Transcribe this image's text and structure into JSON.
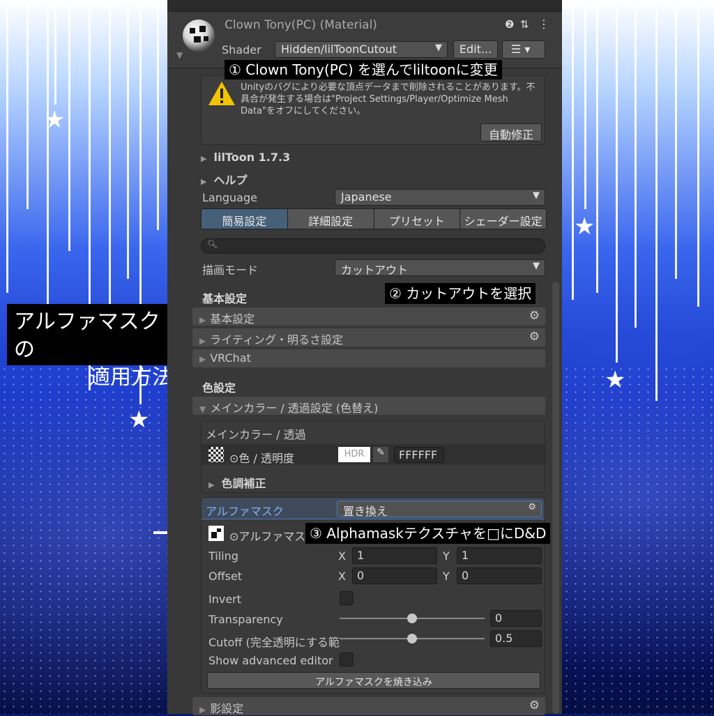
{
  "header": {
    "material_title": "Clown Tony(PC) (Material)",
    "shader_label": "Shader",
    "shader_value": "Hidden/lilToonCutout",
    "edit_label": "Edit...",
    "help_icon": "help-icon",
    "preset_icon": "preset-icon",
    "more_icon": "kebab-icon"
  },
  "warning": {
    "text": "Unityのバグにより必要な頂点データまで削除されることがあります。不具合が発生する場合は\"Project Settings/Player/Optimize Mesh Data\"をオフにしてください。",
    "fix_button": "自動修正"
  },
  "foldouts": {
    "version": "lilToon 1.7.3",
    "help": "ヘルプ"
  },
  "language": {
    "label": "Language",
    "value": "Japanese"
  },
  "tabs": [
    {
      "label": "簡易設定",
      "active": true
    },
    {
      "label": "詳細設定",
      "active": false
    },
    {
      "label": "プリセット",
      "active": false
    },
    {
      "label": "シェーダー設定",
      "active": false
    }
  ],
  "render_mode": {
    "label": "描画モード",
    "value": "カットアウト"
  },
  "basic": {
    "heading": "基本設定",
    "sections": [
      "基本設定",
      "ライティング・明るさ設定",
      "VRChat"
    ]
  },
  "color": {
    "heading": "色設定",
    "main_section": "メインカラー / 透過設定 (色替え)",
    "sub_heading": "メインカラー / 透過",
    "color_label": "⊙色 / 透明度",
    "hdr_label": "HDR",
    "hex_value": "FFFFFF",
    "tone_label": "色調補正"
  },
  "alpha": {
    "label": "アルファマスク",
    "mode": "置き換え",
    "texture_label": "⊙アルファマスク",
    "tiling_label": "Tiling",
    "tiling": {
      "x": "1",
      "y": "1"
    },
    "offset_label": "Offset",
    "offset": {
      "x": "0",
      "y": "0"
    },
    "x_label": "X",
    "y_label": "Y",
    "invert_label": "Invert",
    "transparency_label": "Transparency",
    "transparency_value": "0",
    "transparency_slider": 0.5,
    "cutoff_label": "Cutoff (完全透明にする範",
    "cutoff_value": "0.5",
    "cutoff_slider": 0.5,
    "advanced_label": "Show advanced editor",
    "bake_button": "アルファマスクを焼き込み"
  },
  "shadow": {
    "section": "影設定"
  },
  "annotations": {
    "step1": "① Clown Tony(PC) を選んでliltoonに変更",
    "step2": "② カットアウトを選択",
    "step3": "③ Alphamaskテクスチャを□にD&D",
    "side_line1": "アルファマスクの",
    "side_line2": "適用方法"
  },
  "colors": {
    "panel": "#383838",
    "active_tab": "#46607a",
    "label_blue": "#7fb1ff",
    "warning": "#f2c300"
  }
}
